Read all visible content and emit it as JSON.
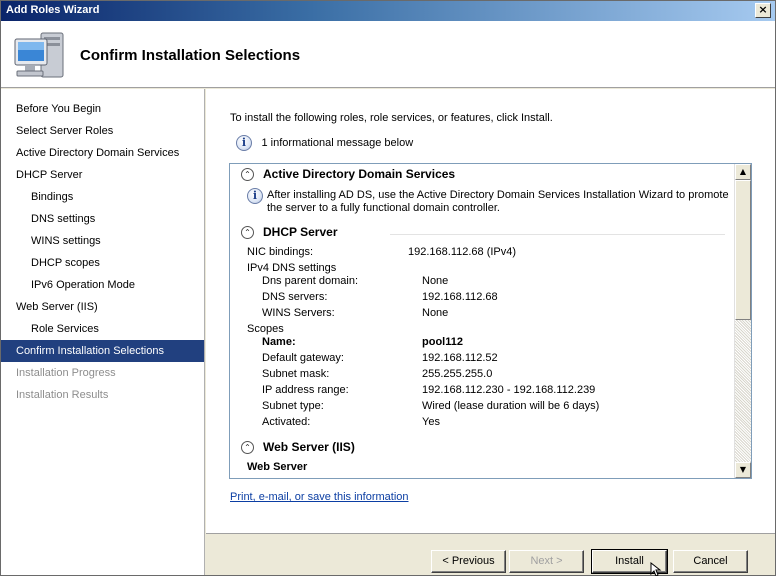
{
  "window": {
    "title": "Add Roles Wizard",
    "close_glyph": "×"
  },
  "header": {
    "heading": "Confirm Installation Selections",
    "icon": "server-computer-icon"
  },
  "sidebar": {
    "items": [
      {
        "label": "Before You Begin"
      },
      {
        "label": "Select Server Roles"
      },
      {
        "label": "Active Directory Domain Services"
      },
      {
        "label": "DHCP Server"
      },
      {
        "label": "Bindings"
      },
      {
        "label": "DNS settings"
      },
      {
        "label": "WINS settings"
      },
      {
        "label": "DHCP scopes"
      },
      {
        "label": "IPv6 Operation Mode"
      },
      {
        "label": "Web Server (IIS)"
      },
      {
        "label": "Role Services"
      },
      {
        "label": "Confirm Installation Selections"
      },
      {
        "label": "Installation Progress"
      },
      {
        "label": "Installation Results"
      }
    ]
  },
  "main": {
    "intro": "To install the following roles, role services, or features, click Install.",
    "info_count": "1 informational message below",
    "info_glyph": "i",
    "print_link": "Print, e-mail, or save this information"
  },
  "adds": {
    "title": "Active Directory Domain Services",
    "message_line1": "After installing AD DS, use the Active Directory Domain Services Installation Wizard to promote",
    "message_line2": "the server to a fully functional domain controller."
  },
  "dhcp": {
    "title": "DHCP Server",
    "nic_label": "NIC bindings:",
    "nic_value": "192.168.112.68 (IPv4)",
    "dns_group": "IPv4 DNS settings",
    "dns_parent_label": "Dns parent domain:",
    "dns_parent_value": "None",
    "dns_servers_label": "DNS servers:",
    "dns_servers_value": "192.168.112.68",
    "wins_label": "WINS Servers:",
    "wins_value": "None",
    "scopes_group": "Scopes",
    "name_label": "Name:",
    "name_value": "pool112",
    "gateway_label": "Default gateway:",
    "gateway_value": "192.168.112.52",
    "subnet_label": "Subnet mask:",
    "subnet_value": "255.255.255.0",
    "range_label": "IP address range:",
    "range_value": "192.168.112.230 - 192.168.112.239",
    "type_label": "Subnet type:",
    "type_value": "Wired (lease duration will be 6 days)",
    "activated_label": "Activated:",
    "activated_value": "Yes"
  },
  "iis": {
    "title": "Web Server (IIS)",
    "subheading": "Web Server"
  },
  "collapse_glyph": "⌃",
  "scroll": {
    "up_glyph": "▲",
    "down_glyph": "▼"
  },
  "buttons": {
    "previous": "< Previous",
    "next": "Next >",
    "install": "Install",
    "cancel": "Cancel"
  }
}
